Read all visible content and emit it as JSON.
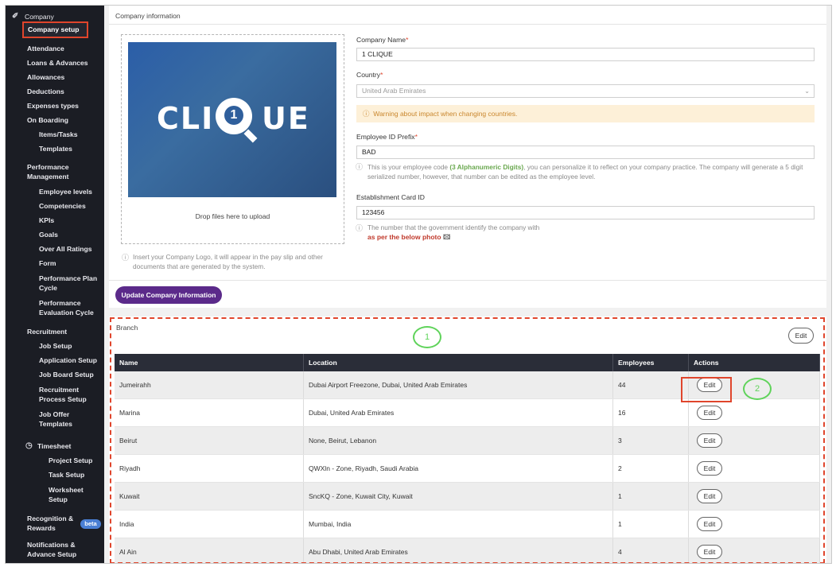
{
  "sidebar": {
    "section": "Company",
    "active": "Company setup",
    "items": [
      "Attendance",
      "Loans & Advances",
      "Allowances",
      "Deductions",
      "Expenses types",
      "On Boarding"
    ],
    "onboarding": [
      "Items/Tasks",
      "Templates"
    ],
    "performance": "Performance Management",
    "performance_items": [
      "Employee levels",
      "Competencies",
      "KPIs",
      "Goals",
      "Over All Ratings",
      "Form",
      "Performance Plan Cycle",
      "Performance Evaluation Cycle"
    ],
    "recruitment": "Recruitment",
    "recruitment_items": [
      "Job Setup",
      "Application Setup",
      "Job Board Setup",
      "Recruitment Process Setup",
      "Job Offer Templates"
    ],
    "timesheet": "Timesheet",
    "timesheet_items": [
      "Project Setup",
      "Task Setup",
      "Worksheet Setup"
    ],
    "recognition": "Recognition & Rewards",
    "beta": "beta",
    "notifications": "Notifications & Advance Setup"
  },
  "company": {
    "panel_title": "Company information",
    "logo_text_left": "CLI",
    "logo_num": "1",
    "logo_text_right": "UE",
    "drop_text": "Drop files here to upload",
    "logo_help": "Insert your Company Logo, it will appear in the pay slip and other documents that are generated by the system.",
    "name_label": "Company Name",
    "name_value": "1 CLIQUE",
    "country_label": "Country",
    "country_value": "United Arab Emirates",
    "warning": "Warning about impact when changing countries.",
    "prefix_label": "Employee ID Prefix",
    "prefix_value": "BAD",
    "prefix_help_1": "This is your employee code ",
    "prefix_help_bold": "(3 Alphanumeric Digits)",
    "prefix_help_2": ", you can personalize it to reflect on your company practice. The company will generate a 5 digit serialized number, however, that number can be edited as the employee level.",
    "card_label": "Establishment Card ID",
    "card_value": "123456",
    "card_help": "The number that the government identify the company with",
    "card_link": "as per the below photo",
    "update_button": "Update Company Information",
    "required_mark": "*"
  },
  "branch": {
    "title": "Branch",
    "edit_button": "Edit",
    "annotation_1": "1",
    "annotation_2": "2",
    "columns": [
      "Name",
      "Location",
      "Employees",
      "Actions"
    ],
    "rows": [
      {
        "name": "Jumeirahh",
        "location": "Dubai Airport Freezone, Dubai, United Arab Emirates",
        "employees": "44",
        "action": "Edit"
      },
      {
        "name": "Marina",
        "location": "Dubai, United Arab Emirates",
        "employees": "16",
        "action": "Edit"
      },
      {
        "name": "Beirut",
        "location": "None, Beirut, Lebanon",
        "employees": "3",
        "action": "Edit"
      },
      {
        "name": "Riyadh",
        "location": "QWXln - Zone, Riyadh, Saudi Arabia",
        "employees": "2",
        "action": "Edit"
      },
      {
        "name": "Kuwait",
        "location": "SncKQ - Zone, Kuwait City, Kuwait",
        "employees": "1",
        "action": "Edit"
      },
      {
        "name": "India",
        "location": "Mumbai, India",
        "employees": "1",
        "action": "Edit"
      },
      {
        "name": "Al Ain",
        "location": "Abu Dhabi, United Arab Emirates",
        "employees": "4",
        "action": "Edit"
      }
    ]
  },
  "colors": {
    "accent": "#5b2a8a",
    "annotation_red": "#e0452c",
    "annotation_green": "#5fd35a",
    "sidebar_bg": "#1b1d24"
  }
}
